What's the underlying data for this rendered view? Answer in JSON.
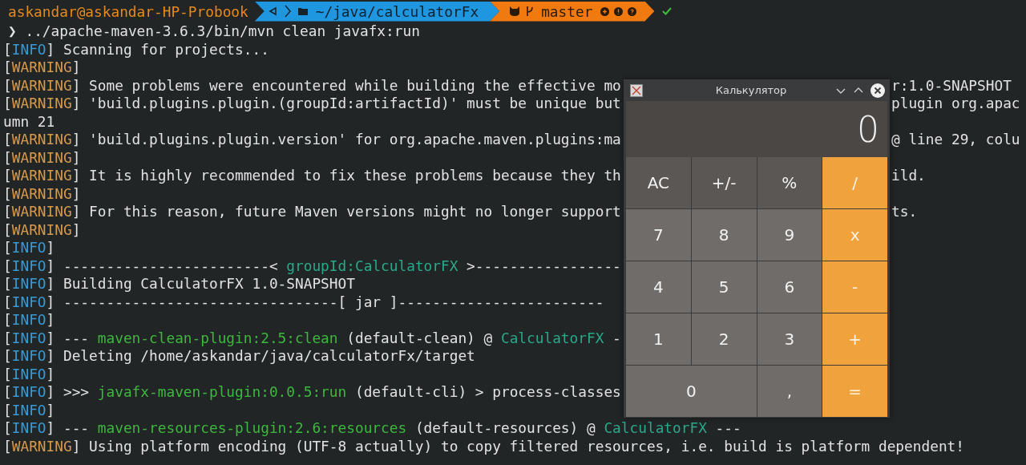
{
  "prompt": {
    "user": "askandar@askandar-HP-Probook",
    "path": "~/java/calculatorFx",
    "branch": "master"
  },
  "command": {
    "symbol": "❯",
    "text": "../apache-maven-3.6.3/bin/mvn clean javafx:run"
  },
  "lines": [
    {
      "segments": [
        {
          "kind": "plain",
          "text": "["
        },
        {
          "kind": "info",
          "text": "INFO"
        },
        {
          "kind": "plain",
          "text": "] Scanning for projects..."
        }
      ]
    },
    {
      "segments": [
        {
          "kind": "plain",
          "text": "["
        },
        {
          "kind": "warning",
          "text": "WARNING"
        },
        {
          "kind": "plain",
          "text": "]"
        }
      ]
    },
    {
      "segments": [
        {
          "kind": "plain",
          "text": "["
        },
        {
          "kind": "warning",
          "text": "WARNING"
        },
        {
          "kind": "plain",
          "text": "] Some problems were encountered while building the effective mo"
        }
      ],
      "right": "r:1.0-SNAPSHOT"
    },
    {
      "segments": [
        {
          "kind": "plain",
          "text": "["
        },
        {
          "kind": "warning",
          "text": "WARNING"
        },
        {
          "kind": "plain",
          "text": "] 'build.plugins.plugin.(groupId:artifactId)' must be unique but"
        }
      ],
      "right": "plugin org.apac"
    },
    {
      "segments": [
        {
          "kind": "plain",
          "text": "umn 21"
        }
      ]
    },
    {
      "segments": [
        {
          "kind": "plain",
          "text": "["
        },
        {
          "kind": "warning",
          "text": "WARNING"
        },
        {
          "kind": "plain",
          "text": "] 'build.plugins.plugin.version' for org.apache.maven.plugins:ma"
        }
      ],
      "right": "@ line 29, colu"
    },
    {
      "segments": [
        {
          "kind": "plain",
          "text": "["
        },
        {
          "kind": "warning",
          "text": "WARNING"
        },
        {
          "kind": "plain",
          "text": "]"
        }
      ]
    },
    {
      "segments": [
        {
          "kind": "plain",
          "text": "["
        },
        {
          "kind": "warning",
          "text": "WARNING"
        },
        {
          "kind": "plain",
          "text": "] It is highly recommended to fix these problems because they th"
        }
      ],
      "right": "ild."
    },
    {
      "segments": [
        {
          "kind": "plain",
          "text": "["
        },
        {
          "kind": "warning",
          "text": "WARNING"
        },
        {
          "kind": "plain",
          "text": "]"
        }
      ]
    },
    {
      "segments": [
        {
          "kind": "plain",
          "text": "["
        },
        {
          "kind": "warning",
          "text": "WARNING"
        },
        {
          "kind": "plain",
          "text": "] For this reason, future Maven versions might no longer support"
        }
      ],
      "right": "ts."
    },
    {
      "segments": [
        {
          "kind": "plain",
          "text": "["
        },
        {
          "kind": "warning",
          "text": "WARNING"
        },
        {
          "kind": "plain",
          "text": "]"
        }
      ]
    },
    {
      "segments": [
        {
          "kind": "plain",
          "text": "["
        },
        {
          "kind": "info",
          "text": "INFO"
        },
        {
          "kind": "plain",
          "text": "]"
        }
      ]
    },
    {
      "segments": [
        {
          "kind": "plain",
          "text": "["
        },
        {
          "kind": "info",
          "text": "INFO"
        },
        {
          "kind": "plain",
          "text": "] ------------------------< "
        },
        {
          "kind": "teal",
          "text": "groupId:CalculatorFX"
        },
        {
          "kind": "plain",
          "text": " >-----------------"
        }
      ]
    },
    {
      "segments": [
        {
          "kind": "plain",
          "text": "["
        },
        {
          "kind": "info",
          "text": "INFO"
        },
        {
          "kind": "plain",
          "text": "] Building CalculatorFX 1.0-SNAPSHOT"
        }
      ]
    },
    {
      "segments": [
        {
          "kind": "plain",
          "text": "["
        },
        {
          "kind": "info",
          "text": "INFO"
        },
        {
          "kind": "plain",
          "text": "] --------------------------------[ jar ]------------------------"
        }
      ]
    },
    {
      "segments": [
        {
          "kind": "plain",
          "text": "["
        },
        {
          "kind": "info",
          "text": "INFO"
        },
        {
          "kind": "plain",
          "text": "]"
        }
      ]
    },
    {
      "segments": [
        {
          "kind": "plain",
          "text": "["
        },
        {
          "kind": "info",
          "text": "INFO"
        },
        {
          "kind": "plain",
          "text": "] --- "
        },
        {
          "kind": "green",
          "text": "maven-clean-plugin:2.5:clean"
        },
        {
          "kind": "plain",
          "text": " (default-clean) @ "
        },
        {
          "kind": "teal",
          "text": "CalculatorFX"
        },
        {
          "kind": "plain",
          "text": " -"
        }
      ]
    },
    {
      "segments": [
        {
          "kind": "plain",
          "text": "["
        },
        {
          "kind": "info",
          "text": "INFO"
        },
        {
          "kind": "plain",
          "text": "] Deleting /home/askandar/java/calculatorFx/target"
        }
      ]
    },
    {
      "segments": [
        {
          "kind": "plain",
          "text": "["
        },
        {
          "kind": "info",
          "text": "INFO"
        },
        {
          "kind": "plain",
          "text": "]"
        }
      ]
    },
    {
      "segments": [
        {
          "kind": "plain",
          "text": "["
        },
        {
          "kind": "info",
          "text": "INFO"
        },
        {
          "kind": "plain",
          "text": "] >>> "
        },
        {
          "kind": "green",
          "text": "javafx-maven-plugin:0.0.5:run"
        },
        {
          "kind": "plain",
          "text": " (default-cli) > process-classes"
        }
      ]
    },
    {
      "segments": [
        {
          "kind": "plain",
          "text": "["
        },
        {
          "kind": "info",
          "text": "INFO"
        },
        {
          "kind": "plain",
          "text": "]"
        }
      ]
    },
    {
      "segments": [
        {
          "kind": "plain",
          "text": "["
        },
        {
          "kind": "info",
          "text": "INFO"
        },
        {
          "kind": "plain",
          "text": "] --- "
        },
        {
          "kind": "green",
          "text": "maven-resources-plugin:2.6:resources"
        },
        {
          "kind": "plain",
          "text": " (default-resources) @ "
        },
        {
          "kind": "teal",
          "text": "CalculatorFX"
        },
        {
          "kind": "plain",
          "text": " ---"
        }
      ]
    },
    {
      "segments": [
        {
          "kind": "plain",
          "text": "["
        },
        {
          "kind": "warning",
          "text": "WARNING"
        },
        {
          "kind": "plain",
          "text": "] Using platform encoding (UTF-8 actually) to copy filtered resources, i.e. build is platform dependent!"
        }
      ]
    }
  ],
  "calculator": {
    "title": "Калькулятор",
    "display": "0",
    "buttons": [
      {
        "label": "AC",
        "kind": "function",
        "wide": false
      },
      {
        "label": "+/-",
        "kind": "function",
        "wide": false
      },
      {
        "label": "%",
        "kind": "function",
        "wide": false
      },
      {
        "label": "/",
        "kind": "operator",
        "wide": false
      },
      {
        "label": "7",
        "kind": "digit",
        "wide": false
      },
      {
        "label": "8",
        "kind": "digit",
        "wide": false
      },
      {
        "label": "9",
        "kind": "digit",
        "wide": false
      },
      {
        "label": "x",
        "kind": "operator",
        "wide": false
      },
      {
        "label": "4",
        "kind": "digit",
        "wide": false
      },
      {
        "label": "5",
        "kind": "digit",
        "wide": false
      },
      {
        "label": "6",
        "kind": "digit",
        "wide": false
      },
      {
        "label": "-",
        "kind": "operator",
        "wide": false
      },
      {
        "label": "1",
        "kind": "digit",
        "wide": false
      },
      {
        "label": "2",
        "kind": "digit",
        "wide": false
      },
      {
        "label": "3",
        "kind": "digit",
        "wide": false
      },
      {
        "label": "+",
        "kind": "operator",
        "wide": false
      },
      {
        "label": "0",
        "kind": "digit",
        "wide": true
      },
      {
        "label": ",",
        "kind": "digit",
        "wide": false
      },
      {
        "label": "=",
        "kind": "operator",
        "wide": false
      }
    ]
  }
}
